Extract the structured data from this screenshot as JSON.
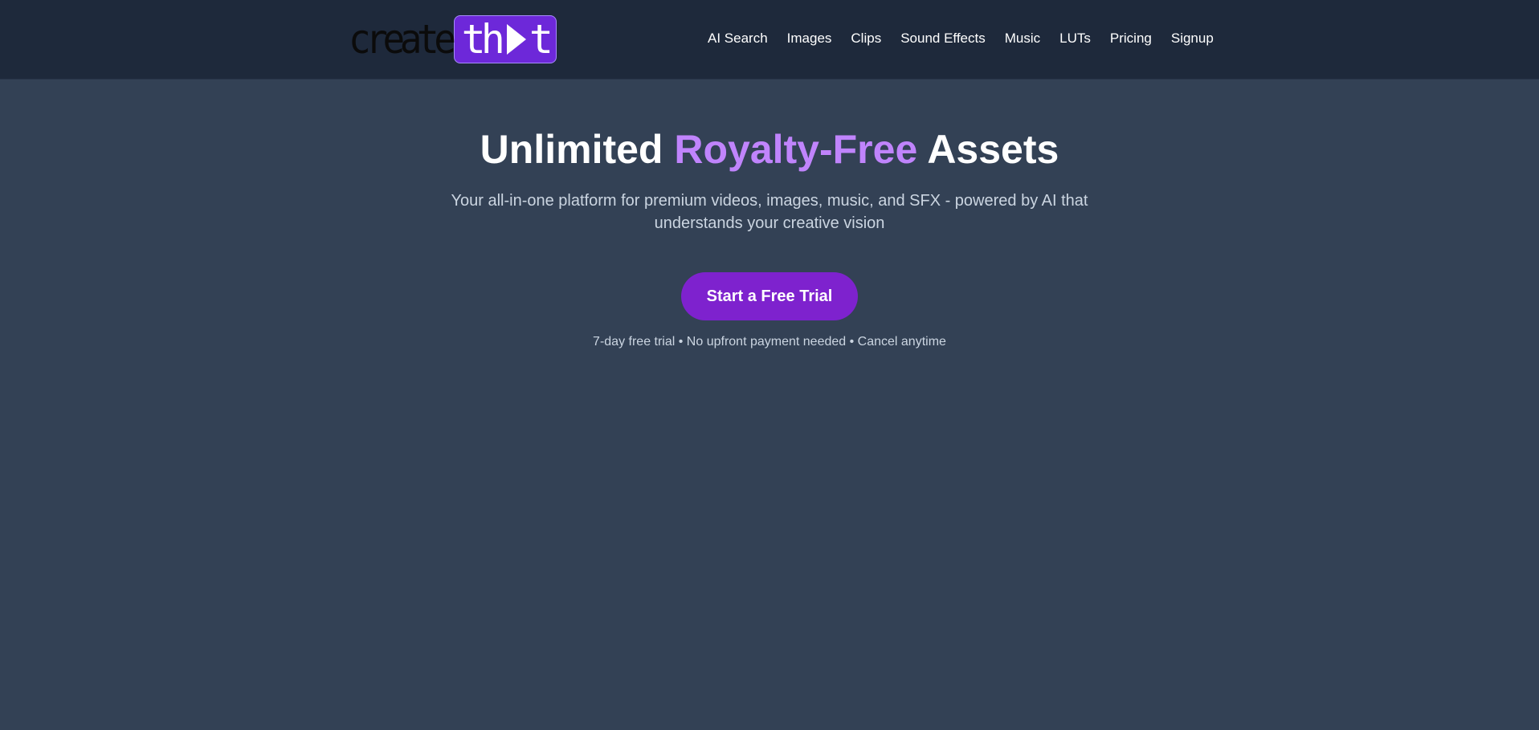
{
  "logo": {
    "create": "create",
    "that_prefix": "th",
    "that_suffix": "t"
  },
  "nav": {
    "items": [
      {
        "label": "AI Search"
      },
      {
        "label": "Images"
      },
      {
        "label": "Clips"
      },
      {
        "label": "Sound Effects"
      },
      {
        "label": "Music"
      },
      {
        "label": "LUTs"
      },
      {
        "label": "Pricing"
      },
      {
        "label": "Signup"
      }
    ]
  },
  "hero": {
    "title_start": "Unlimited",
    "title_accent": "Royalty-Free",
    "title_end": "Assets",
    "subtitle": "Your all-in-one platform for premium videos, images, music, and SFX - powered by AI that understands your creative vision",
    "cta_label": "Start a Free Trial",
    "trial_note": "7-day free trial • No upfront payment needed • Cancel anytime"
  },
  "colors": {
    "page_bg": "#334155",
    "header_bg": "#1e293b",
    "accent": "#c084fc",
    "brand": "#7e22ce"
  },
  "icons": {
    "logo_play": "play-icon"
  }
}
